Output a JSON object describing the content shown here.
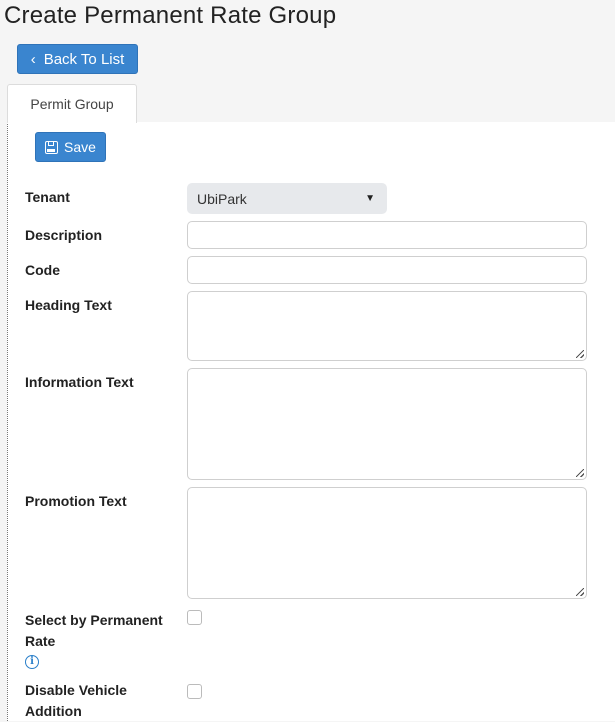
{
  "page": {
    "title": "Create Permanent Rate Group"
  },
  "toolbar": {
    "back_label": "Back To List",
    "save_label": "Save"
  },
  "tabs": [
    {
      "label": "Permit Group",
      "active": true
    }
  ],
  "form": {
    "tenant": {
      "label": "Tenant",
      "value": "UbiPark"
    },
    "description": {
      "label": "Description",
      "value": ""
    },
    "code": {
      "label": "Code",
      "value": ""
    },
    "heading_text": {
      "label": "Heading Text",
      "value": ""
    },
    "information_text": {
      "label": "Information Text",
      "value": ""
    },
    "promotion_text": {
      "label": "Promotion Text",
      "value": ""
    },
    "select_by_permanent_rate": {
      "label_line1": "Select by Permanent",
      "label_line2": "Rate",
      "checked": false
    },
    "disable_vehicle_addition": {
      "label_line1": "Disable Vehicle",
      "label_line2": "Addition",
      "checked": false
    }
  },
  "icons": {
    "back": "chevron-left-icon",
    "save": "floppy-disk-icon",
    "caret": "caret-down-icon",
    "info": "info-icon"
  },
  "colors": {
    "primary": "#3a85cf",
    "info": "#2a7fc9"
  }
}
